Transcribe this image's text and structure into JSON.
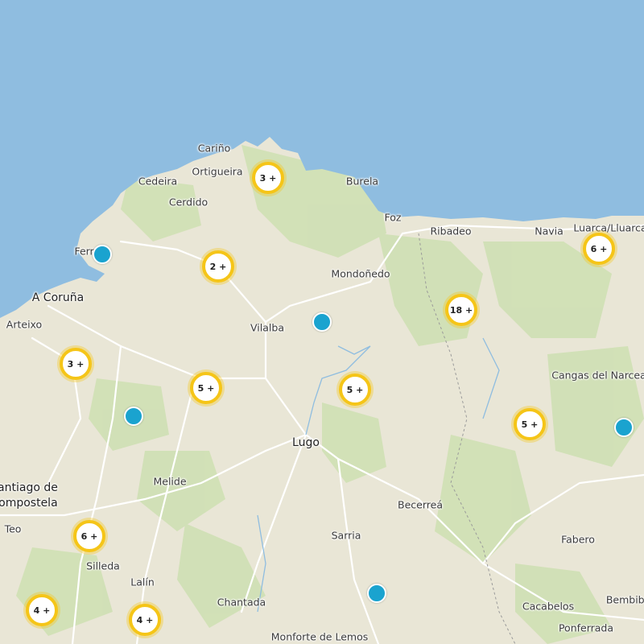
{
  "colors": {
    "sea": "#8fbde0",
    "land": "#e9e6d6",
    "green": "#cfe0b4",
    "cluster_ring": "#f5c518",
    "pin": "#1aa3cf"
  },
  "places": [
    {
      "name": "Cariño",
      "big": false
    },
    {
      "name": "Ortigueira",
      "big": false
    },
    {
      "name": "Cedeira",
      "big": false
    },
    {
      "name": "Cerdido",
      "big": false
    },
    {
      "name": "Burela",
      "big": false
    },
    {
      "name": "Foz",
      "big": false
    },
    {
      "name": "Ribadeo",
      "big": false
    },
    {
      "name": "Navia",
      "big": false
    },
    {
      "name": "Luarca/Lluarca",
      "big": false
    },
    {
      "name": "Ferrol",
      "big": false
    },
    {
      "name": "Mondoñedo",
      "big": false
    },
    {
      "name": "A Coruña",
      "big": true
    },
    {
      "name": "Arteixo",
      "big": false
    },
    {
      "name": "Vilalba",
      "big": false
    },
    {
      "name": "Cangas del Narcea",
      "big": false
    },
    {
      "name": "Lugo",
      "big": true
    },
    {
      "name": "Melide",
      "big": false
    },
    {
      "name": "Santiago de",
      "big": true
    },
    {
      "name": "Compostela",
      "big": true
    },
    {
      "name": "Becerreá",
      "big": false
    },
    {
      "name": "Teo",
      "big": false
    },
    {
      "name": "Sarria",
      "big": false
    },
    {
      "name": "Fabero",
      "big": false
    },
    {
      "name": "Silleda",
      "big": false
    },
    {
      "name": "Lalín",
      "big": false
    },
    {
      "name": "Chantada",
      "big": false
    },
    {
      "name": "Cacabelos",
      "big": false
    },
    {
      "name": "Bembibre",
      "big": false
    },
    {
      "name": "Ponferrada",
      "big": false
    },
    {
      "name": "Monforte de Lemos",
      "big": false
    }
  ],
  "clusters": [
    {
      "label": "3 +"
    },
    {
      "label": "2 +"
    },
    {
      "label": "6 +"
    },
    {
      "label": "18 +"
    },
    {
      "label": "3 +"
    },
    {
      "label": "5 +"
    },
    {
      "label": "5 +"
    },
    {
      "label": "5 +"
    },
    {
      "label": "6 +"
    },
    {
      "label": "4 +"
    },
    {
      "label": "4 +"
    }
  ],
  "pins": [
    {
      "name": "marker"
    },
    {
      "name": "marker"
    },
    {
      "name": "marker"
    },
    {
      "name": "marker"
    },
    {
      "name": "marker"
    }
  ]
}
